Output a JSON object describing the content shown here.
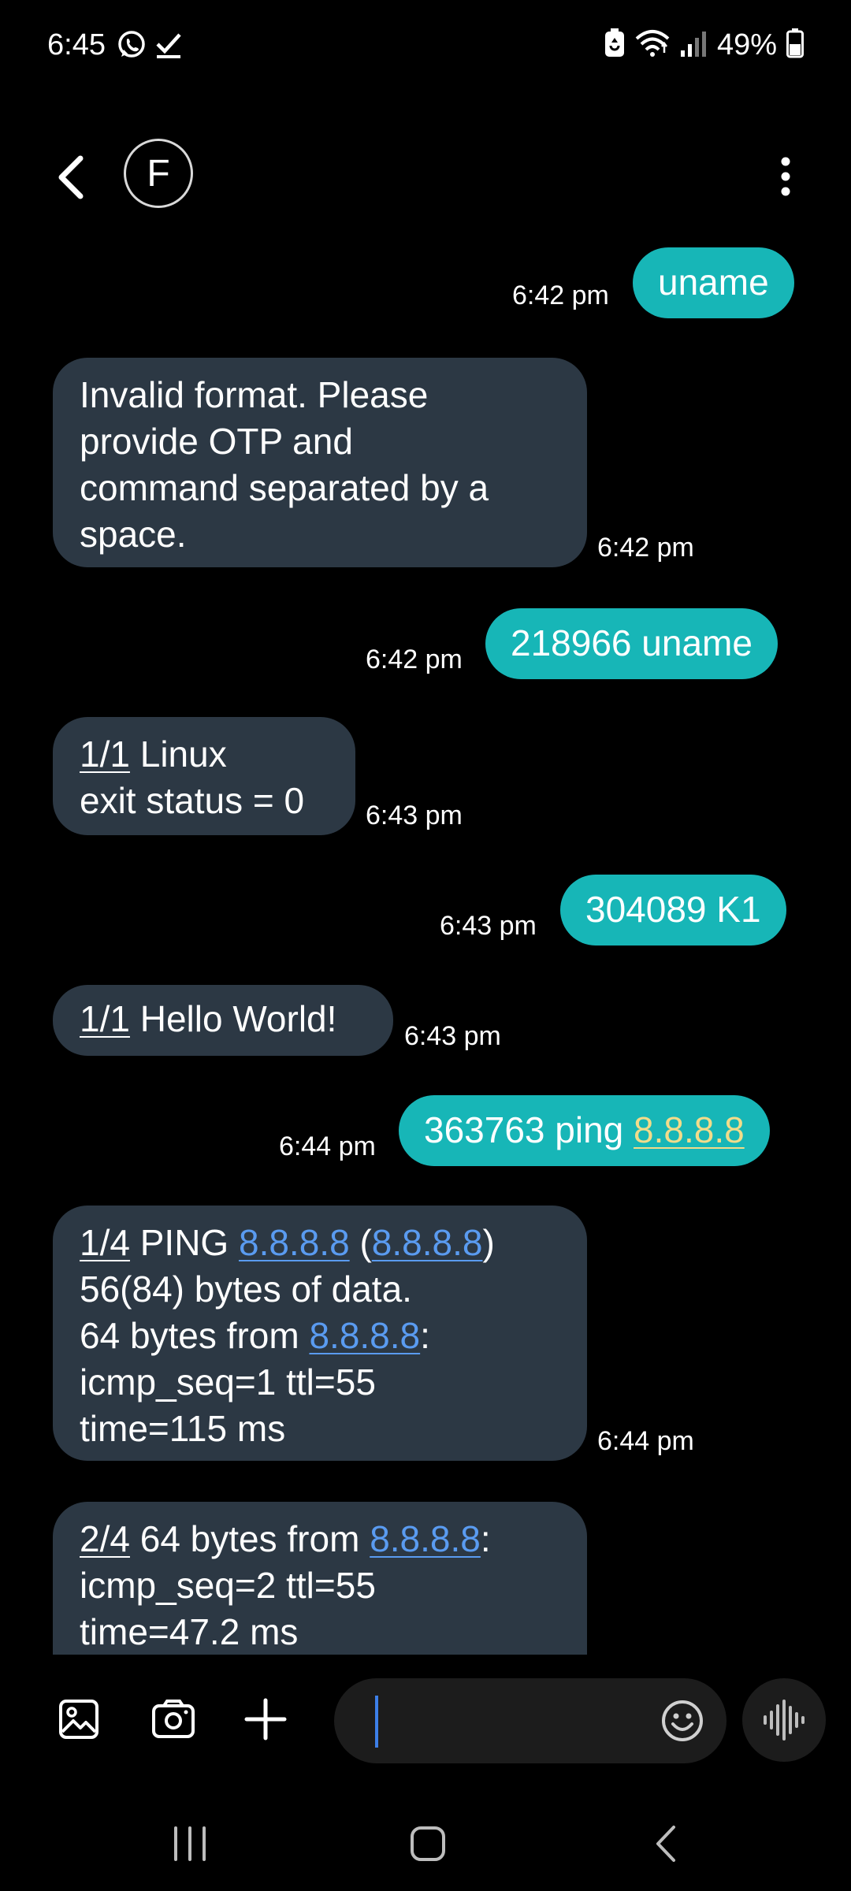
{
  "status_bar": {
    "time": "6:45",
    "battery_percent": "49%",
    "left_icons": [
      "whatsapp-icon",
      "check-icon"
    ],
    "right_icons": [
      "battery-saver-icon",
      "wifi-icon",
      "signal-icon",
      "battery-icon"
    ]
  },
  "header": {
    "avatar_letter": "F"
  },
  "messages": [
    {
      "type": "sent",
      "text": "uname",
      "time": "6:42 pm"
    },
    {
      "type": "received",
      "lines": [
        "Invalid format. Please",
        "provide OTP and",
        "command separated by a",
        "space."
      ],
      "time": "6:42 pm"
    },
    {
      "type": "sent",
      "text": "218966 uname",
      "time": "6:42 pm"
    },
    {
      "type": "received",
      "prefix": "1/1",
      "lines": [
        " Linux",
        "exit status = 0"
      ],
      "time": "6:43 pm"
    },
    {
      "type": "sent",
      "text": "304089 K1",
      "time": "6:43 pm"
    },
    {
      "type": "received",
      "prefix": "1/1",
      "lines": [
        " Hello World!"
      ],
      "time": "6:43 pm"
    },
    {
      "type": "sent",
      "text": "363763 ping ",
      "link": "8.8.8.8",
      "time": "6:44 pm"
    },
    {
      "type": "received",
      "prefix": "1/4",
      "parts": {
        "l1a": " PING ",
        "l1link1": "8.8.8.8",
        "l1b": " (",
        "l1link2": "8.8.8.8",
        "l1c": ")",
        "l2": "56(84) bytes of data.",
        "l3a": "64 bytes from ",
        "l3link": "8.8.8.8",
        "l3b": ":",
        "l4": "icmp_seq=1 ttl=55",
        "l5": "time=115 ms"
      },
      "time": "6:44 pm"
    },
    {
      "type": "received",
      "prefix": "2/4",
      "parts": {
        "l1a": " 64 bytes from ",
        "l1link": "8.8.8.8",
        "l1b": ":",
        "l2": "icmp_seq=2 ttl=55",
        "l3": "time=47.2 ms"
      }
    }
  ],
  "composer": {
    "input_value": "",
    "icons": [
      "gallery-icon",
      "camera-icon",
      "plus-icon",
      "emoji-icon",
      "voice-record-icon"
    ]
  },
  "navbar": {
    "icons": [
      "recents-icon",
      "home-icon",
      "back-icon"
    ]
  },
  "colors": {
    "background": "#000000",
    "sent_bubble": "#17b6b7",
    "received_bubble": "#2c3844",
    "link_blue": "#5a9bf0",
    "link_yellow": "#f2dc8a"
  }
}
